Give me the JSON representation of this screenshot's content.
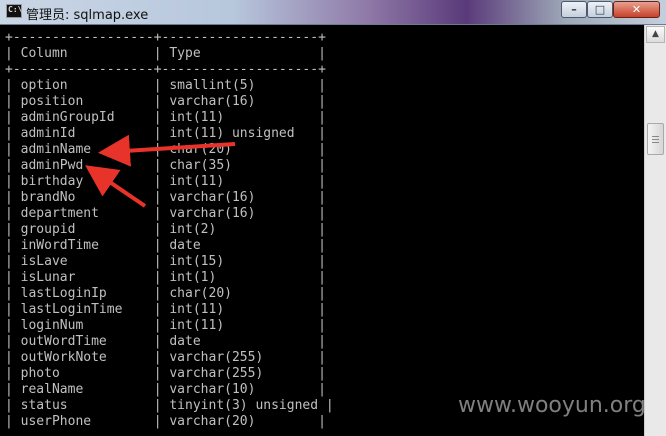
{
  "window": {
    "title": "管理员: sqlmap.exe",
    "icon_label": "C:\\",
    "buttons": {
      "minimize": "–",
      "maximize": "□",
      "close": "✕"
    }
  },
  "console": {
    "top_border": "+------------------+--------------------+",
    "header_line": "| Column           | Type               |",
    "mid_border": "+------------------+--------------------+",
    "rows": [
      "| option           | smallint(5)        |",
      "| position         | varchar(16)        |",
      "| adminGroupId     | int(11)            |",
      "| adminId          | int(11) unsigned   |",
      "| adminName        | char(20)           |",
      "| adminPwd         | char(35)           |",
      "| birthday         | int(11)            |",
      "| brandNo          | varchar(16)        |",
      "| department       | varchar(16)        |",
      "| groupid          | int(2)             |",
      "| inWordTime       | date               |",
      "| isLave           | int(15)            |",
      "| isLunar          | int(1)             |",
      "| lastLoginIp      | char(20)           |",
      "| lastLoginTime    | int(11)            |",
      "| loginNum         | int(11)            |",
      "| outWordTime      | date               |",
      "| outWorkNote      | varchar(255)       |",
      "| photo            | varchar(255)       |",
      "| realName         | varchar(10)        |",
      "| status           | tinyint(3) unsigned |",
      "| userPhone        | varchar(20)        |"
    ]
  },
  "scrollbar": {
    "up_arrow": "▲",
    "position_fraction": 0.25
  },
  "annotations": {
    "arrow_color": "#e8332a",
    "targets": [
      "adminName",
      "adminPwd"
    ]
  },
  "watermark": "www.wooyun.org"
}
